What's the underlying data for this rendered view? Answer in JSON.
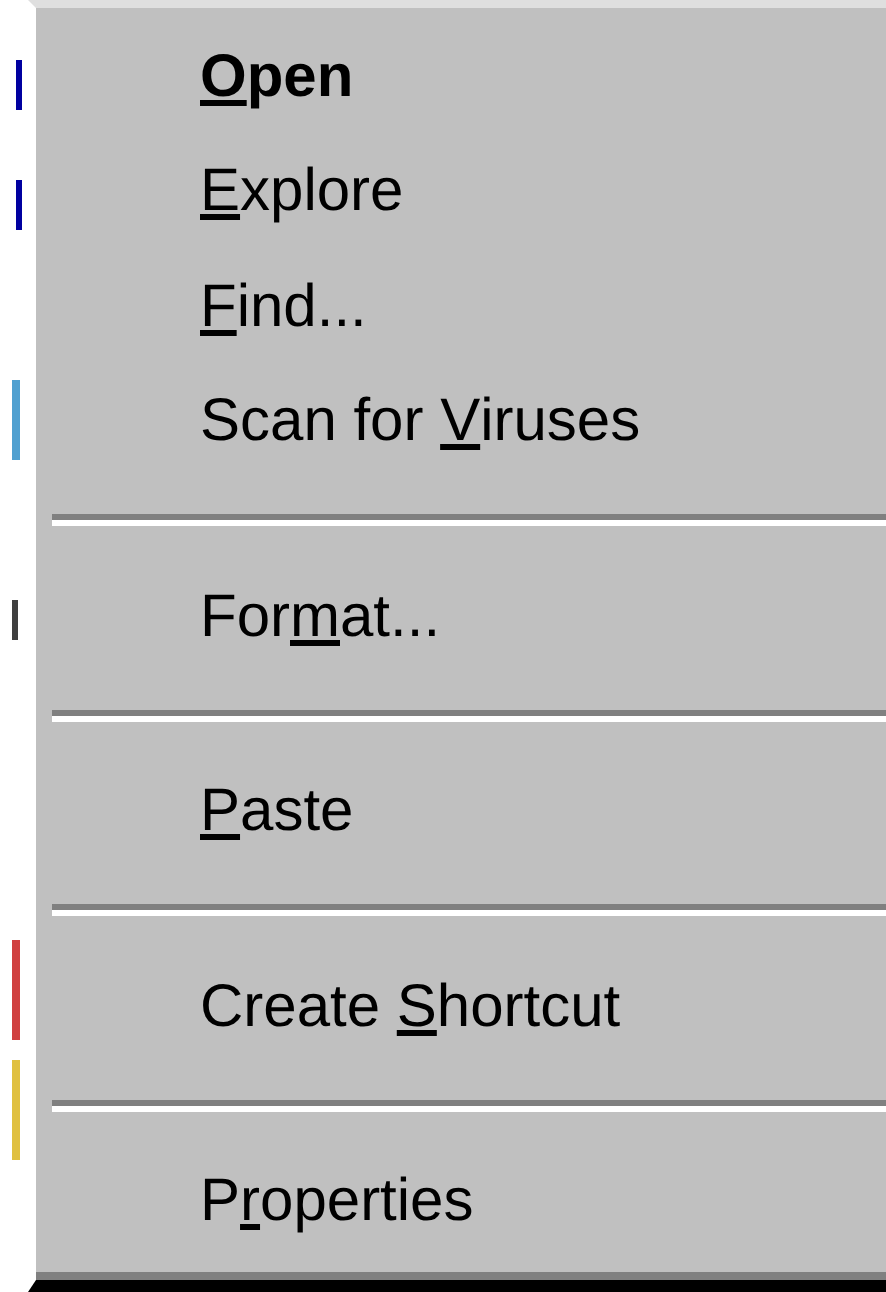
{
  "menu": {
    "groups": [
      [
        {
          "key": "O",
          "after": "pen",
          "default": true
        },
        {
          "key": "E",
          "after": "xplore",
          "default": false
        },
        {
          "key": "F",
          "after": "ind...",
          "default": false
        },
        {
          "before": "Scan for ",
          "key": "V",
          "after": "iruses",
          "default": false
        }
      ],
      [
        {
          "before": "For",
          "key": "m",
          "after": "at...",
          "default": false
        }
      ],
      [
        {
          "key": "P",
          "after": "aste",
          "default": false
        }
      ],
      [
        {
          "before": "Create ",
          "key": "S",
          "after": "hortcut",
          "default": false
        }
      ],
      [
        {
          "before": "P",
          "key": "r",
          "after": "operties",
          "default": false
        }
      ]
    ]
  }
}
